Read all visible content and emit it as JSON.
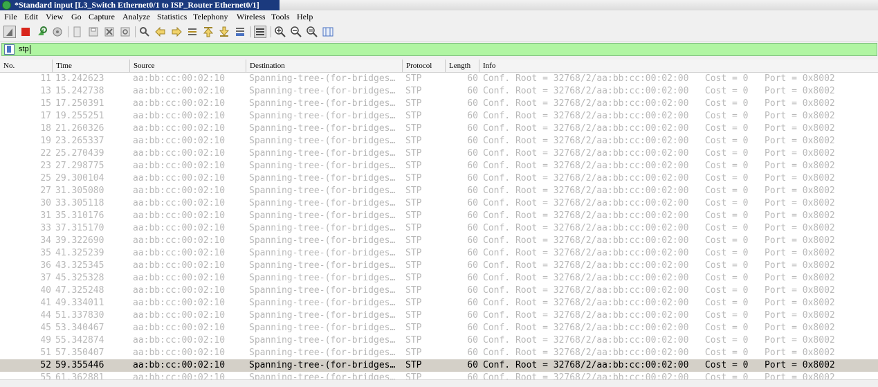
{
  "window": {
    "title": "*Standard input [L3_Switch Ethernet0/1 to ISP_Router Ethernet0/1]"
  },
  "menu": [
    "File",
    "Edit",
    "View",
    "Go",
    "Capture",
    "Analyze",
    "Statistics",
    "Telephony",
    "Wireless",
    "Tools",
    "Help"
  ],
  "toolbar": {
    "icons": [
      "shark-fin-start-icon",
      "stop-capture-icon",
      "restart-capture-icon",
      "capture-options-icon",
      "open-file-icon",
      "save-file-icon",
      "close-file-icon",
      "reload-file-icon",
      "find-packet-icon",
      "go-back-icon",
      "go-forward-icon",
      "go-to-packet-icon",
      "go-first-icon",
      "go-last-icon",
      "auto-scroll-icon",
      "colorize-icon",
      "zoom-in-icon",
      "zoom-out-icon",
      "normal-size-icon",
      "resize-columns-icon"
    ]
  },
  "filter": {
    "value": "stp"
  },
  "columns": [
    "No.",
    "Time",
    "Source",
    "Destination",
    "Protocol",
    "Length",
    "Info"
  ],
  "packets": [
    [
      "11",
      "13.242623",
      "aa:bb:cc:00:02:10",
      "Spanning-tree-(for-bridges…",
      "STP",
      "60",
      "Conf. Root = 32768/2/aa:bb:cc:00:02:00   Cost = 0   Port = 0x8002"
    ],
    [
      "13",
      "15.242738",
      "aa:bb:cc:00:02:10",
      "Spanning-tree-(for-bridges…",
      "STP",
      "60",
      "Conf. Root = 32768/2/aa:bb:cc:00:02:00   Cost = 0   Port = 0x8002"
    ],
    [
      "15",
      "17.250391",
      "aa:bb:cc:00:02:10",
      "Spanning-tree-(for-bridges…",
      "STP",
      "60",
      "Conf. Root = 32768/2/aa:bb:cc:00:02:00   Cost = 0   Port = 0x8002"
    ],
    [
      "17",
      "19.255251",
      "aa:bb:cc:00:02:10",
      "Spanning-tree-(for-bridges…",
      "STP",
      "60",
      "Conf. Root = 32768/2/aa:bb:cc:00:02:00   Cost = 0   Port = 0x8002"
    ],
    [
      "18",
      "21.260326",
      "aa:bb:cc:00:02:10",
      "Spanning-tree-(for-bridges…",
      "STP",
      "60",
      "Conf. Root = 32768/2/aa:bb:cc:00:02:00   Cost = 0   Port = 0x8002"
    ],
    [
      "19",
      "23.265337",
      "aa:bb:cc:00:02:10",
      "Spanning-tree-(for-bridges…",
      "STP",
      "60",
      "Conf. Root = 32768/2/aa:bb:cc:00:02:00   Cost = 0   Port = 0x8002"
    ],
    [
      "22",
      "25.270439",
      "aa:bb:cc:00:02:10",
      "Spanning-tree-(for-bridges…",
      "STP",
      "60",
      "Conf. Root = 32768/2/aa:bb:cc:00:02:00   Cost = 0   Port = 0x8002"
    ],
    [
      "23",
      "27.298775",
      "aa:bb:cc:00:02:10",
      "Spanning-tree-(for-bridges…",
      "STP",
      "60",
      "Conf. Root = 32768/2/aa:bb:cc:00:02:00   Cost = 0   Port = 0x8002"
    ],
    [
      "25",
      "29.300104",
      "aa:bb:cc:00:02:10",
      "Spanning-tree-(for-bridges…",
      "STP",
      "60",
      "Conf. Root = 32768/2/aa:bb:cc:00:02:00   Cost = 0   Port = 0x8002"
    ],
    [
      "27",
      "31.305080",
      "aa:bb:cc:00:02:10",
      "Spanning-tree-(for-bridges…",
      "STP",
      "60",
      "Conf. Root = 32768/2/aa:bb:cc:00:02:00   Cost = 0   Port = 0x8002"
    ],
    [
      "30",
      "33.305118",
      "aa:bb:cc:00:02:10",
      "Spanning-tree-(for-bridges…",
      "STP",
      "60",
      "Conf. Root = 32768/2/aa:bb:cc:00:02:00   Cost = 0   Port = 0x8002"
    ],
    [
      "31",
      "35.310176",
      "aa:bb:cc:00:02:10",
      "Spanning-tree-(for-bridges…",
      "STP",
      "60",
      "Conf. Root = 32768/2/aa:bb:cc:00:02:00   Cost = 0   Port = 0x8002"
    ],
    [
      "33",
      "37.315170",
      "aa:bb:cc:00:02:10",
      "Spanning-tree-(for-bridges…",
      "STP",
      "60",
      "Conf. Root = 32768/2/aa:bb:cc:00:02:00   Cost = 0   Port = 0x8002"
    ],
    [
      "34",
      "39.322690",
      "aa:bb:cc:00:02:10",
      "Spanning-tree-(for-bridges…",
      "STP",
      "60",
      "Conf. Root = 32768/2/aa:bb:cc:00:02:00   Cost = 0   Port = 0x8002"
    ],
    [
      "35",
      "41.325239",
      "aa:bb:cc:00:02:10",
      "Spanning-tree-(for-bridges…",
      "STP",
      "60",
      "Conf. Root = 32768/2/aa:bb:cc:00:02:00   Cost = 0   Port = 0x8002"
    ],
    [
      "36",
      "43.325345",
      "aa:bb:cc:00:02:10",
      "Spanning-tree-(for-bridges…",
      "STP",
      "60",
      "Conf. Root = 32768/2/aa:bb:cc:00:02:00   Cost = 0   Port = 0x8002"
    ],
    [
      "37",
      "45.325328",
      "aa:bb:cc:00:02:10",
      "Spanning-tree-(for-bridges…",
      "STP",
      "60",
      "Conf. Root = 32768/2/aa:bb:cc:00:02:00   Cost = 0   Port = 0x8002"
    ],
    [
      "40",
      "47.325248",
      "aa:bb:cc:00:02:10",
      "Spanning-tree-(for-bridges…",
      "STP",
      "60",
      "Conf. Root = 32768/2/aa:bb:cc:00:02:00   Cost = 0   Port = 0x8002"
    ],
    [
      "41",
      "49.334011",
      "aa:bb:cc:00:02:10",
      "Spanning-tree-(for-bridges…",
      "STP",
      "60",
      "Conf. Root = 32768/2/aa:bb:cc:00:02:00   Cost = 0   Port = 0x8002"
    ],
    [
      "44",
      "51.337830",
      "aa:bb:cc:00:02:10",
      "Spanning-tree-(for-bridges…",
      "STP",
      "60",
      "Conf. Root = 32768/2/aa:bb:cc:00:02:00   Cost = 0   Port = 0x8002"
    ],
    [
      "45",
      "53.340467",
      "aa:bb:cc:00:02:10",
      "Spanning-tree-(for-bridges…",
      "STP",
      "60",
      "Conf. Root = 32768/2/aa:bb:cc:00:02:00   Cost = 0   Port = 0x8002"
    ],
    [
      "49",
      "55.342874",
      "aa:bb:cc:00:02:10",
      "Spanning-tree-(for-bridges…",
      "STP",
      "60",
      "Conf. Root = 32768/2/aa:bb:cc:00:02:00   Cost = 0   Port = 0x8002"
    ],
    [
      "51",
      "57.350407",
      "aa:bb:cc:00:02:10",
      "Spanning-tree-(for-bridges…",
      "STP",
      "60",
      "Conf. Root = 32768/2/aa:bb:cc:00:02:00   Cost = 0   Port = 0x8002"
    ],
    [
      "52",
      "59.355446",
      "aa:bb:cc:00:02:10",
      "Spanning-tree-(for-bridges…",
      "STP",
      "60",
      "Conf. Root = 32768/2/aa:bb:cc:00:02:00   Cost = 0   Port = 0x8002"
    ],
    [
      "55",
      "61.362881",
      "aa:bb:cc:00:02:10",
      "Spanning-tree-(for-bridges…",
      "STP",
      "60",
      "Conf. Root = 32768/2/aa:bb:cc:00:02:00   Cost = 0   Port = 0x8002"
    ]
  ],
  "selected_row": 23
}
